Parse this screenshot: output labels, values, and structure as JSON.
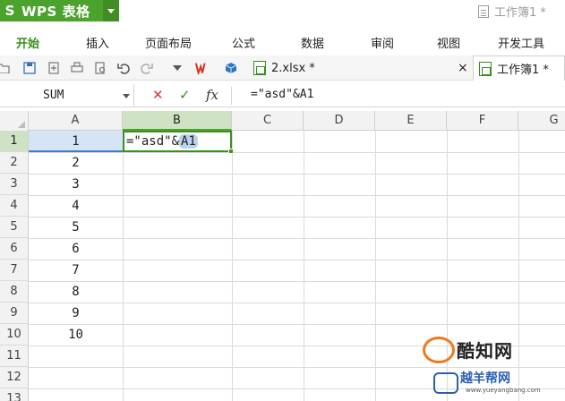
{
  "app": {
    "name": "WPS 表格",
    "logo_letter": "S",
    "window_title": "工作簿1 *"
  },
  "menu": {
    "items": [
      "开始",
      "插入",
      "页面布局",
      "公式",
      "数据",
      "审阅",
      "视图",
      "开发工具"
    ],
    "active": "开始"
  },
  "toolbar": {
    "icons": [
      "open-icon",
      "save-icon",
      "export-icon",
      "print-icon",
      "print-preview-icon",
      "undo-icon",
      "redo-icon",
      "more-dropdown-icon",
      "wps-logo-icon",
      "cube-icon"
    ],
    "tabs": [
      {
        "label": "2.xlsx *",
        "close": ""
      },
      {
        "label": "×",
        "close": ""
      }
    ],
    "active_tab": "工作簿1 *"
  },
  "formula_bar": {
    "name_box": "SUM",
    "cancel_symbol": "✕",
    "confirm_symbol": "✓",
    "fx_label": "fx",
    "content": "=\"asd\"&A1"
  },
  "sheet": {
    "columns": [
      "A",
      "B",
      "C",
      "D",
      "E",
      "F",
      "G"
    ],
    "rows": [
      "1",
      "2",
      "3",
      "4",
      "5",
      "6",
      "7",
      "8",
      "9",
      "10",
      "11",
      "12",
      "13"
    ],
    "a_values": [
      "1",
      "2",
      "3",
      "4",
      "5",
      "6",
      "7",
      "8",
      "9",
      "10",
      "",
      "",
      ""
    ],
    "editing_cell": {
      "prefix": "=\"asd\"&",
      "ref": "A1"
    }
  },
  "watermark": {
    "brand": "酷知网",
    "sub": "越羊帮网",
    "url": "www.yueyangbang.com"
  },
  "colors": {
    "brand_green": "#4ba22d",
    "selection_blue": "#3f7cc2",
    "watermark_orange": "#f07a1a"
  }
}
